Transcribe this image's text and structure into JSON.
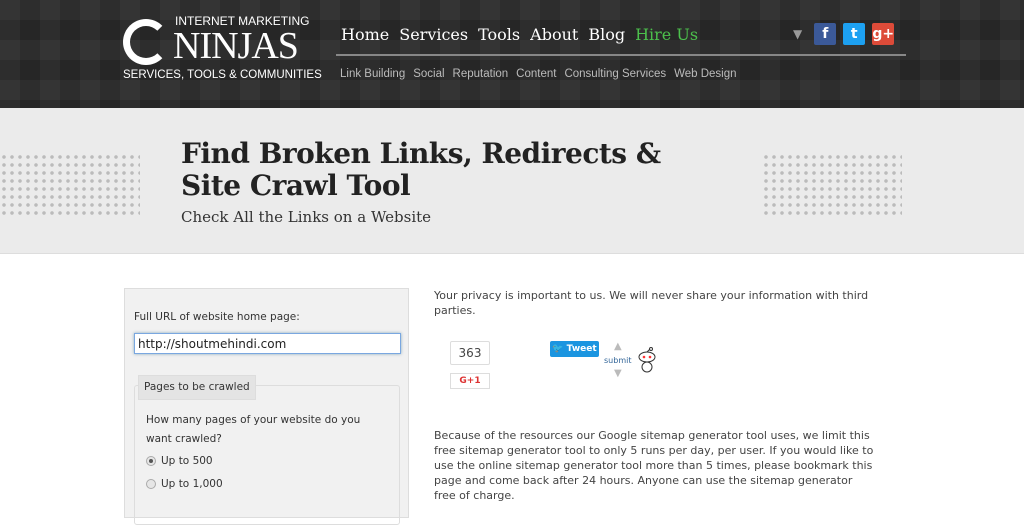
{
  "logo": {
    "top": "INTERNET MARKETING",
    "big": "NINJAS",
    "bottom": "SERVICES, TOOLS & COMMUNITIES"
  },
  "nav": {
    "main": [
      "Home",
      "Services",
      "Tools",
      "About",
      "Blog",
      "Hire Us"
    ],
    "sub": [
      "Link Building",
      "Social",
      "Reputation",
      "Content",
      "Consulting Services",
      "Web Design"
    ]
  },
  "social": {
    "icons": [
      "facebook-icon",
      "twitter-icon",
      "google-plus-icon"
    ],
    "labels": [
      "f",
      "t",
      "g+"
    ],
    "colors": [
      "#3b5998",
      "#1da1f2",
      "#dd4b39"
    ]
  },
  "hero": {
    "title_line1": "Find Broken Links, Redirects &",
    "title_line2": "Site Crawl Tool",
    "subtitle": "Check All the Links on a Website"
  },
  "form": {
    "url_label": "Full URL of website home page:",
    "url_value": "http://shoutmehindi.com",
    "fieldset_legend": "Pages to be crawled",
    "question": "How many pages of your website do you want crawled?",
    "options": [
      {
        "label": "Up to 500",
        "selected": true
      },
      {
        "label": "Up to 1,000",
        "selected": false
      }
    ]
  },
  "privacy": "Your privacy is important to us. We will never share your information with third parties.",
  "share": {
    "gplus_count": "363",
    "gplus_label": "G+1",
    "tweet_label": "Tweet",
    "reddit_label": "submit"
  },
  "limit_text": "Because of the resources our Google sitemap generator tool uses, we limit this free sitemap generator tool to only 5 runs per day, per user. If you would like to use the online sitemap generator tool more than 5 times, please bookmark this page and come back after 24 hours. Anyone can use the sitemap generator free of charge.",
  "colors": {
    "hire_us": "#4cc04c",
    "header_bg": "#262626",
    "hero_bg": "#ebebeb"
  }
}
